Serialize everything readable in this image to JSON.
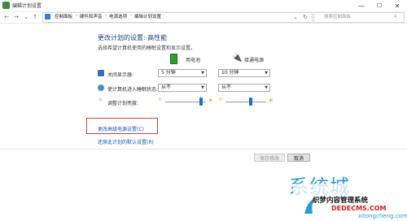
{
  "window": {
    "title": "编辑计划设置",
    "minimize": "—",
    "maximize": "☐",
    "close": "✕"
  },
  "address": {
    "back": "←",
    "forward": "→",
    "recent": "⌄",
    "up": "↑",
    "breadcrumbs": [
      "控制面板",
      "硬件和声音",
      "电源选项",
      "编辑计划设置"
    ],
    "separator": "›",
    "dropdown": "⌄",
    "refresh": "↻",
    "search_placeholder": "搜索控制面板"
  },
  "content": {
    "heading": "更改计划的设置: 高性能",
    "description": "选择希望计算机使用的睡眠设置和显示设置。",
    "columns": {
      "battery": "用电池",
      "plugged": "接通电源"
    },
    "rows": [
      {
        "label": "关闭显示器:",
        "battery_value": "5 分钟",
        "plugged_value": "10 分钟"
      },
      {
        "label": "使计算机进入睡眠状态:",
        "battery_value": "从不",
        "plugged_value": "从不"
      },
      {
        "label": "调整计划亮度:"
      }
    ],
    "brightness": {
      "battery_level": 0.87,
      "plugged_level": 0.62
    },
    "advanced_link": "更改高级电源设置(C)",
    "restore_link": "还原此计划的默认设置(R)",
    "save_button": "保存修改",
    "cancel_button": "取消"
  },
  "watermark": {
    "logo": "系统城",
    "domain": "xitongcheng.com",
    "site_name": "织梦内容管理系统",
    "site_url": "DEDECMS.COM"
  },
  "colors": {
    "heading": "#1e3f88",
    "link": "#1a56b8",
    "highlight": "#d44040",
    "slider": "#1a73c9"
  }
}
